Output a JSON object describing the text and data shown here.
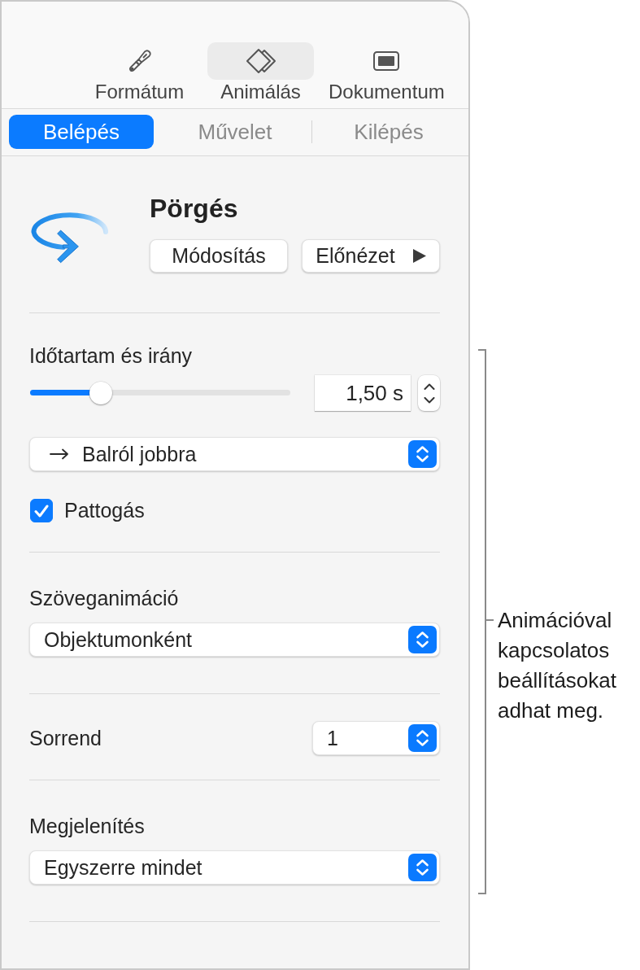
{
  "toolbar": {
    "tabs": [
      {
        "label": "Formátum",
        "selected": false
      },
      {
        "label": "Animálás",
        "selected": true
      },
      {
        "label": "Dokumentum",
        "selected": false
      }
    ]
  },
  "build_tabs": [
    {
      "label": "Belépés",
      "selected": true
    },
    {
      "label": "Művelet",
      "selected": false
    },
    {
      "label": "Kilépés",
      "selected": false
    }
  ],
  "effect": {
    "title": "Pörgés",
    "buttons": [
      {
        "label": "Módosítás",
        "kind": "plain"
      },
      {
        "label": "Előnézet",
        "kind": "play"
      }
    ]
  },
  "duration": {
    "label": "Időtartam és irány",
    "slider": {
      "level": 0.25
    },
    "value": "1,50 s",
    "direction": "Balról jobbra",
    "bounce": {
      "label": "Pattogás",
      "checked": true
    }
  },
  "text_animation": {
    "label": "Szöveganimáció",
    "value": "Objektumonként"
  },
  "order": {
    "label": "Sorrend",
    "value": "1"
  },
  "delivery": {
    "label": "Megjelenítés",
    "value": "Egyszerre mindet"
  },
  "callout": {
    "text": "Animációval kapcsolatos beállításokat adhat meg."
  }
}
